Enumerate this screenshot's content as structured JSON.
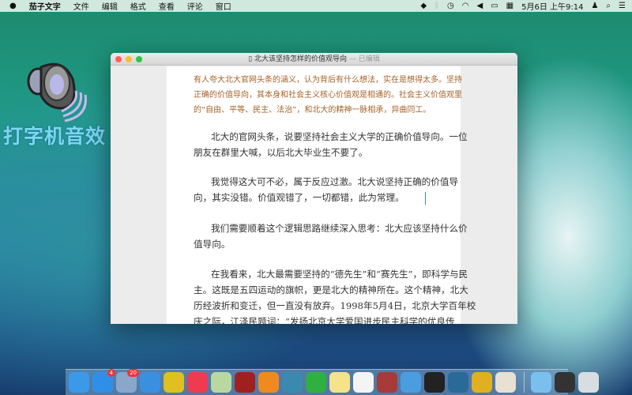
{
  "menubar": {
    "apple": "",
    "items": [
      "茄子文字",
      "文件",
      "编辑",
      "格式",
      "查看",
      "评论",
      "窗口"
    ],
    "clock": "5月6日 上午9:14"
  },
  "desktop_widget": {
    "label": "打字机音效"
  },
  "window": {
    "title": "北大该坚持怎样的价值观导向",
    "status": "— 已编辑"
  },
  "document": {
    "quote_lines": [
      "有人夸大北大官网头条的涵义，认为背后有什么想法，实在是想得太多。坚持",
      "正确的价值导向，其本身和社会主义核心价值观是相通的。社会主义价值观里",
      "的“自由、平等、民主、法治”，和北大的精神一脉相承，异曲同工。"
    ],
    "paragraphs": [
      [
        "北大的官网头条，说要坚持社会主义大学的正确价值导向。一位",
        "朋友在群里大喊，以后北大毕业生不要了。"
      ],
      [
        "我觉得这大可不必，属于反应过激。北大说坚持正确的价值导",
        "向，其实没错。价值观错了，一切都错，此为常理。"
      ],
      [
        "我们需要顺着这个逻辑思路继续深入思考：北大应该坚持什么价",
        "值导向。"
      ],
      [
        "在我看来，北大最需要坚持的“德先生”和“赛先生”，即科学与民",
        "主。这既是五四运动的旗帜，更是北大的精神所在。这个精神，北大",
        "历经波折和变迁，但一直没有放弃。1998年5月4日，北京大学百年校",
        "庆之际，江泽民题词：“发扬北京大学爱国进步民主科学的优良传"
      ]
    ]
  },
  "dock": [
    {
      "name": "finder",
      "color": "#3a9ae8"
    },
    {
      "name": "app-store",
      "color": "#2f8fe8",
      "badge": "4"
    },
    {
      "name": "preview",
      "color": "#8aa6c8",
      "badge": "20"
    },
    {
      "name": "safari",
      "color": "#3b8fe0"
    },
    {
      "name": "qq-music",
      "color": "#e0c020"
    },
    {
      "name": "itunes",
      "color": "#f03a50"
    },
    {
      "name": "maps",
      "color": "#b8d8a0"
    },
    {
      "name": "photo-booth",
      "color": "#a02020"
    },
    {
      "name": "ibooks",
      "color": "#f08a20"
    },
    {
      "name": "iphoto",
      "color": "#3a8ab0"
    },
    {
      "name": "evernote",
      "color": "#2fb040"
    },
    {
      "name": "notes",
      "color": "#f5e28a"
    },
    {
      "name": "reminders",
      "color": "#f4f4f4"
    },
    {
      "name": "dictionary",
      "color": "#a83a3a"
    },
    {
      "name": "xcode",
      "color": "#4a9ee0"
    },
    {
      "name": "terminal",
      "color": "#222222"
    },
    {
      "name": "sourcetree",
      "color": "#2a6a98"
    },
    {
      "name": "chrome",
      "color": "#e0b020"
    },
    {
      "name": "script-editor",
      "color": "#e8e0d0"
    },
    {
      "name": "downloads-folder",
      "color": "#7ac0ef",
      "sep": true
    },
    {
      "name": "stacks",
      "color": "#333333"
    },
    {
      "name": "trash",
      "color": "#d8dde2"
    }
  ]
}
